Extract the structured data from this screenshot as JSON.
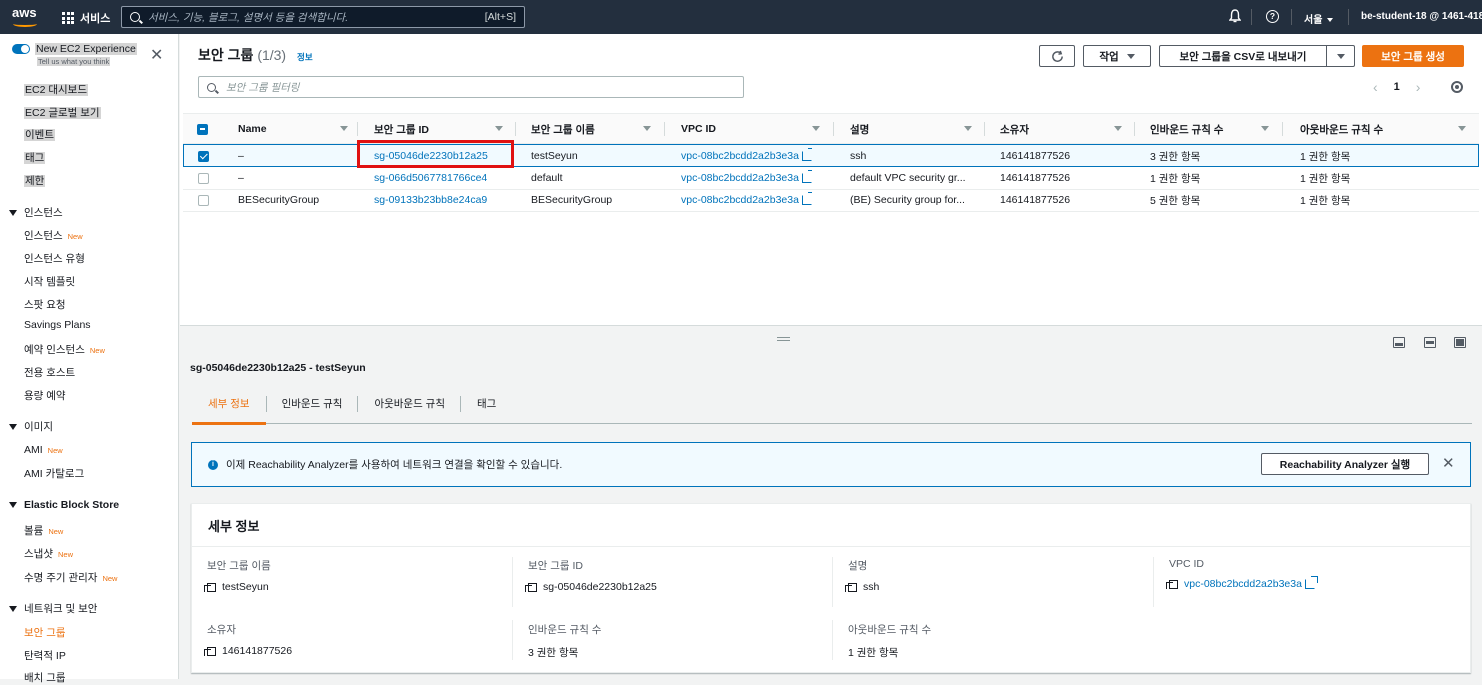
{
  "topbar": {
    "logo": "aws",
    "services": "서비스",
    "search_placeholder": "서비스, 기능, 블로그, 설명서 등을 검색합니다.",
    "search_shortcut": "[Alt+S]",
    "region": "서울",
    "account": "be-student-18 @ 1461-4187-"
  },
  "sidebar": {
    "new_experience": "New EC2 Experience",
    "tell_us": "Tell us what you think",
    "top_items": [
      "EC2 대시보드",
      "EC2 글로벌 보기",
      "이벤트",
      "태그",
      "제한"
    ],
    "sections": [
      {
        "title": "인스턴스",
        "items": [
          {
            "label": "인스턴스",
            "new": "New"
          },
          {
            "label": "인스턴스 유형"
          },
          {
            "label": "시작 템플릿"
          },
          {
            "label": "스팟 요청"
          },
          {
            "label": "Savings Plans"
          },
          {
            "label": "예약 인스턴스",
            "new": "New"
          },
          {
            "label": "전용 호스트"
          },
          {
            "label": "용량 예약"
          }
        ]
      },
      {
        "title": "이미지",
        "items": [
          {
            "label": "AMI",
            "new": "New"
          },
          {
            "label": "AMI 카탈로그"
          }
        ]
      },
      {
        "title": "Elastic Block Store",
        "items": [
          {
            "label": "볼륨",
            "new": "New"
          },
          {
            "label": "스냅샷",
            "new": "New"
          },
          {
            "label": "수명 주기 관리자",
            "new": "New"
          }
        ]
      },
      {
        "title": "네트워크 및 보안",
        "items": [
          {
            "label": "보안 그룹"
          },
          {
            "label": "탄력적 IP"
          },
          {
            "label": "배치 그룹"
          }
        ]
      }
    ]
  },
  "main": {
    "title": "보안 그룹",
    "count": "(1/3)",
    "info": "정보",
    "actions_label": "작업",
    "export_label": "보안 그룹을 CSV로 내보내기",
    "create_label": "보안 그룹 생성",
    "filter_placeholder": "보안 그룹 필터링",
    "page": "1",
    "columns": [
      "Name",
      "보안 그룹 ID",
      "보안 그룹 이름",
      "VPC ID",
      "설명",
      "소유자",
      "인바운드 규칙 수",
      "아웃바운드 규칙 수"
    ],
    "rows": [
      {
        "name": "–",
        "id": "sg-05046de2230b12a25",
        "group_name": "testSeyun",
        "vpc": "vpc-08bc2bcdd2a2b3e3a",
        "desc": "ssh",
        "owner": "146141877526",
        "inbound": "3 권한 항목",
        "outbound": "1 권한 항목",
        "selected": true
      },
      {
        "name": "–",
        "id": "sg-066d5067781766ce4",
        "group_name": "default",
        "vpc": "vpc-08bc2bcdd2a2b3e3a",
        "desc": "default VPC security gr...",
        "owner": "146141877526",
        "inbound": "1 권한 항목",
        "outbound": "1 권한 항목",
        "selected": false
      },
      {
        "name": "BESecurityGroup",
        "id": "sg-09133b23bb8e24ca9",
        "group_name": "BESecurityGroup",
        "vpc": "vpc-08bc2bcdd2a2b3e3a",
        "desc": "(BE) Security group for...",
        "owner": "146141877526",
        "inbound": "5 권한 항목",
        "outbound": "1 권한 항목",
        "selected": false
      }
    ]
  },
  "detail": {
    "heading": "sg-05046de2230b12a25 - testSeyun",
    "tabs": [
      "세부 정보",
      "인바운드 규칙",
      "아웃바운드 규칙",
      "태그"
    ],
    "alert_text": "이제 Reachability Analyzer를 사용하여 네트워크 연결을 확인할 수 있습니다.",
    "alert_button": "Reachability Analyzer 실행",
    "card_title": "세부 정보",
    "fields": {
      "group_name": {
        "k": "보안 그룹 이름",
        "v": "testSeyun"
      },
      "group_id": {
        "k": "보안 그룹 ID",
        "v": "sg-05046de2230b12a25"
      },
      "desc": {
        "k": "설명",
        "v": "ssh"
      },
      "vpc": {
        "k": "VPC ID",
        "v": "vpc-08bc2bcdd2a2b3e3a"
      },
      "owner": {
        "k": "소유자",
        "v": "146141877526"
      },
      "inbound": {
        "k": "인바운드 규칙 수",
        "v": "3 권한 항목"
      },
      "outbound": {
        "k": "아웃바운드 규칙 수",
        "v": "1 권한 항목"
      }
    }
  }
}
